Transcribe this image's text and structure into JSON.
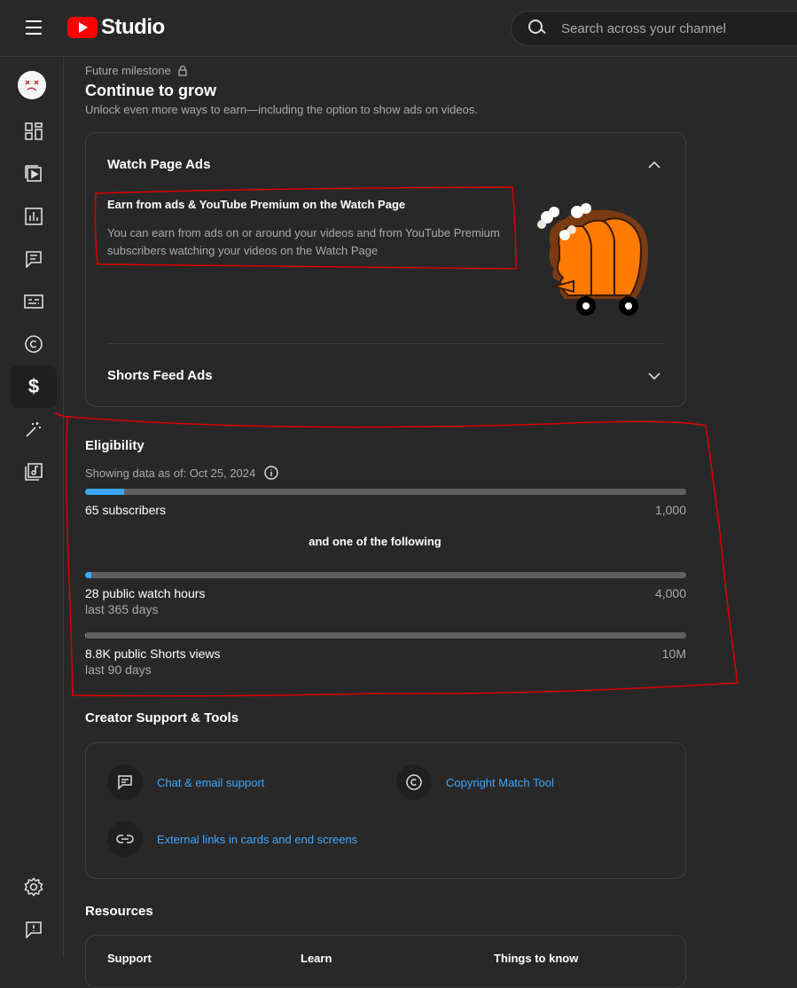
{
  "header": {
    "logo_text": "Studio",
    "search_placeholder": "Search across your channel"
  },
  "sidebar": {
    "items": [
      {
        "name": "dashboard-icon"
      },
      {
        "name": "content-icon"
      },
      {
        "name": "analytics-icon"
      },
      {
        "name": "comments-icon"
      },
      {
        "name": "subtitles-icon"
      },
      {
        "name": "copyright-icon"
      },
      {
        "name": "earn-icon",
        "active": true
      },
      {
        "name": "customization-icon"
      },
      {
        "name": "audio-library-icon"
      }
    ],
    "bottom": [
      {
        "name": "settings-icon"
      },
      {
        "name": "feedback-icon"
      }
    ]
  },
  "milestone": {
    "label": "Future milestone",
    "title": "Continue to grow",
    "subtitle": "Unlock even more ways to earn—including the option to show ads on videos."
  },
  "accordion": {
    "watch_page": {
      "title": "Watch Page Ads",
      "earn_title": "Earn from ads & YouTube Premium on the Watch Page",
      "earn_body": "You can earn from ads on or around your videos and from YouTube Premium subscribers watching your videos on the Watch Page"
    },
    "shorts": {
      "title": "Shorts Feed Ads"
    }
  },
  "eligibility": {
    "title": "Eligibility",
    "showing": "Showing data as of: Oct 25, 2024",
    "subscribers": {
      "label": "65 subscribers",
      "goal": "1,000",
      "progress": 0.065
    },
    "and_one": "and one of the following",
    "watch_hours": {
      "label": "28 public watch hours",
      "goal": "4,000",
      "sub": "last 365 days",
      "progress": 0.007
    },
    "shorts_views": {
      "label": "8.8K public Shorts views",
      "goal": "10M",
      "sub": "last 90 days",
      "progress": 0.00088
    }
  },
  "tools": {
    "title": "Creator Support & Tools",
    "chat": "Chat & email support",
    "copyright": "Copyright Match Tool",
    "links": "External links in cards and end screens"
  },
  "resources": {
    "title": "Resources",
    "cols": [
      "Support",
      "Learn",
      "Things to know"
    ]
  },
  "colors": {
    "accent": "#3ea6ff",
    "annotation": "#e00000",
    "brand": "#ff0000"
  }
}
